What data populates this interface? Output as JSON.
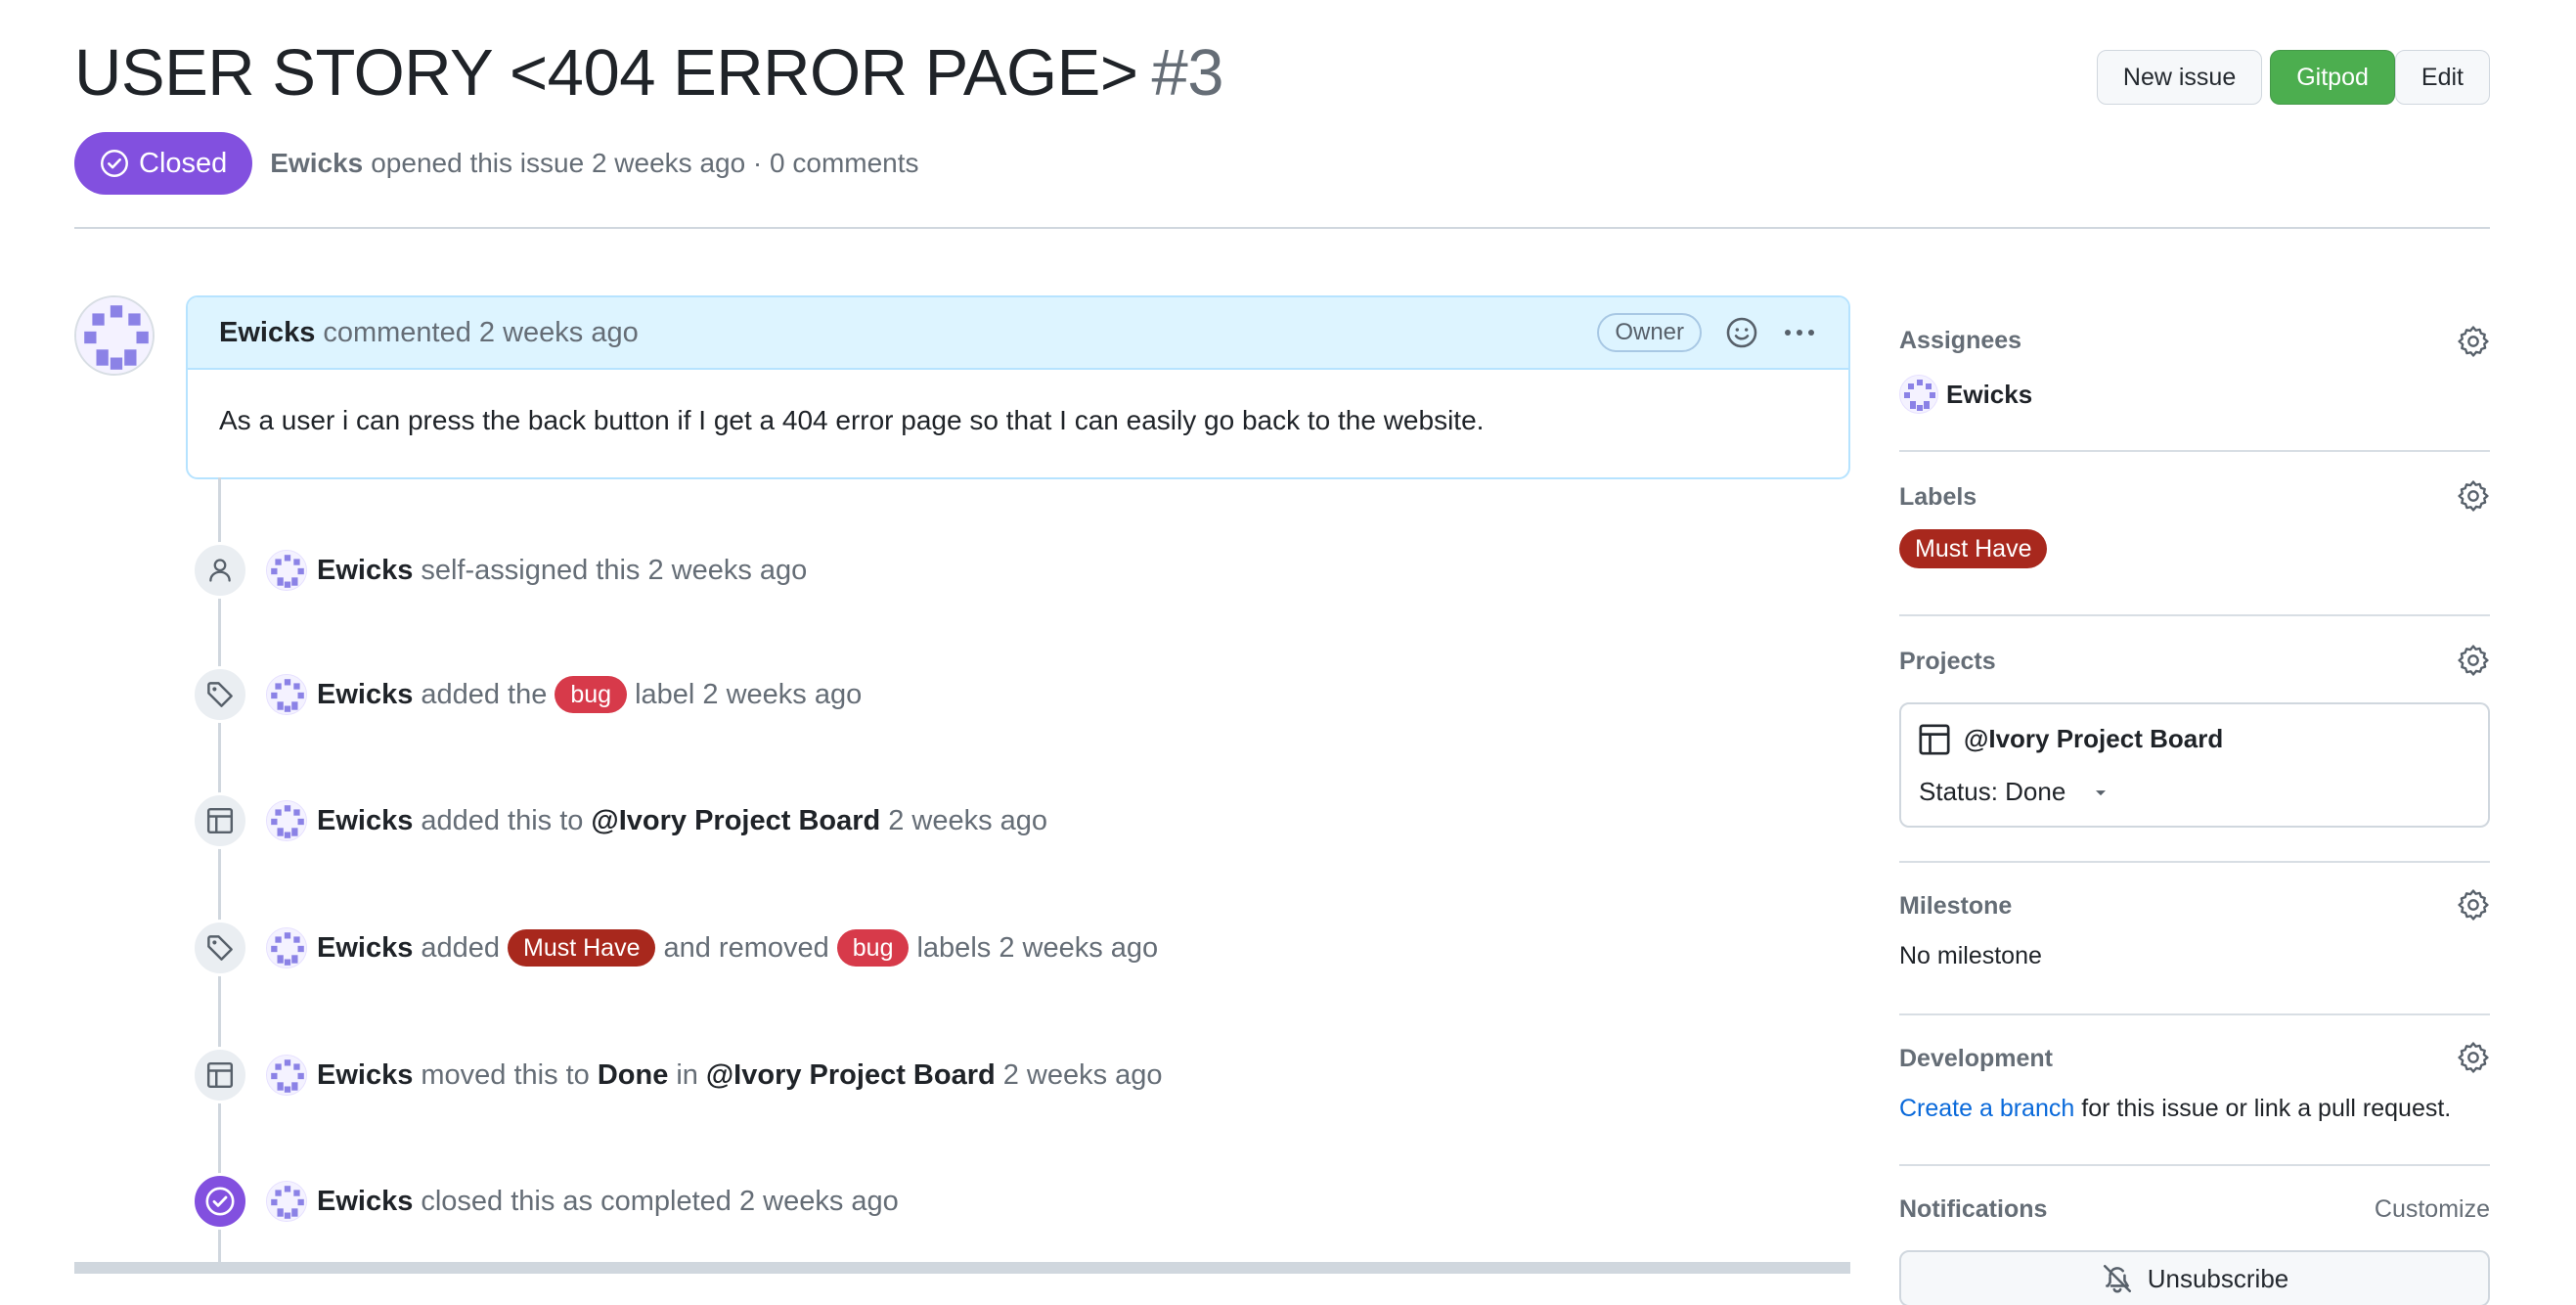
{
  "header": {
    "title": "USER STORY <404 ERROR PAGE>",
    "number": "#3",
    "buttons": {
      "new_issue": "New issue",
      "gitpod": "Gitpod",
      "edit": "Edit"
    }
  },
  "state": {
    "badge": "Closed",
    "author": "Ewicks",
    "meta": "opened this issue 2 weeks ago · 0 comments"
  },
  "comment": {
    "author": "Ewicks",
    "meta": "commented 2 weeks ago",
    "role_badge": "Owner",
    "body": "As a user i can press the back button if I get a 404 error page so that I can easily go back to the website."
  },
  "events": [
    {
      "icon": "person-icon",
      "actor": "Ewicks",
      "text": "self-assigned this 2 weeks ago"
    },
    {
      "icon": "tag-icon",
      "actor": "Ewicks",
      "pre": "added the",
      "label": "bug",
      "post": "label 2 weeks ago"
    },
    {
      "icon": "table-icon",
      "actor": "Ewicks",
      "pre": "added this to",
      "target": "@Ivory Project Board",
      "post": "2 weeks ago"
    },
    {
      "icon": "tag-icon",
      "actor": "Ewicks",
      "pre": "added",
      "label1": "Must Have",
      "mid": "and removed",
      "label2": "bug",
      "post": "labels 2 weeks ago"
    },
    {
      "icon": "table-icon",
      "actor": "Ewicks",
      "pre": "moved this to",
      "column": "Done",
      "in": "in",
      "target": "@Ivory Project Board",
      "post": "2 weeks ago"
    },
    {
      "icon": "check-circle-icon",
      "actor": "Ewicks",
      "text": "closed this as completed 2 weeks ago"
    }
  ],
  "sidebar": {
    "assignees": {
      "title": "Assignees",
      "user": "Ewicks"
    },
    "labels": {
      "title": "Labels",
      "label": "Must Have"
    },
    "projects": {
      "title": "Projects",
      "name": "@Ivory Project Board",
      "status": "Status: Done"
    },
    "milestone": {
      "title": "Milestone",
      "value": "No milestone"
    },
    "development": {
      "title": "Development",
      "link": "Create a branch",
      "rest": "for this issue or link a pull request."
    },
    "notifications": {
      "title": "Notifications",
      "customize": "Customize",
      "button": "Unsubscribe"
    }
  },
  "colors": {
    "closed_badge": "#8250df",
    "gitpod_button": "#4cae4f",
    "bug_label": "#d73a4a",
    "must_have_label": "#a8281d",
    "link": "#0969da"
  }
}
